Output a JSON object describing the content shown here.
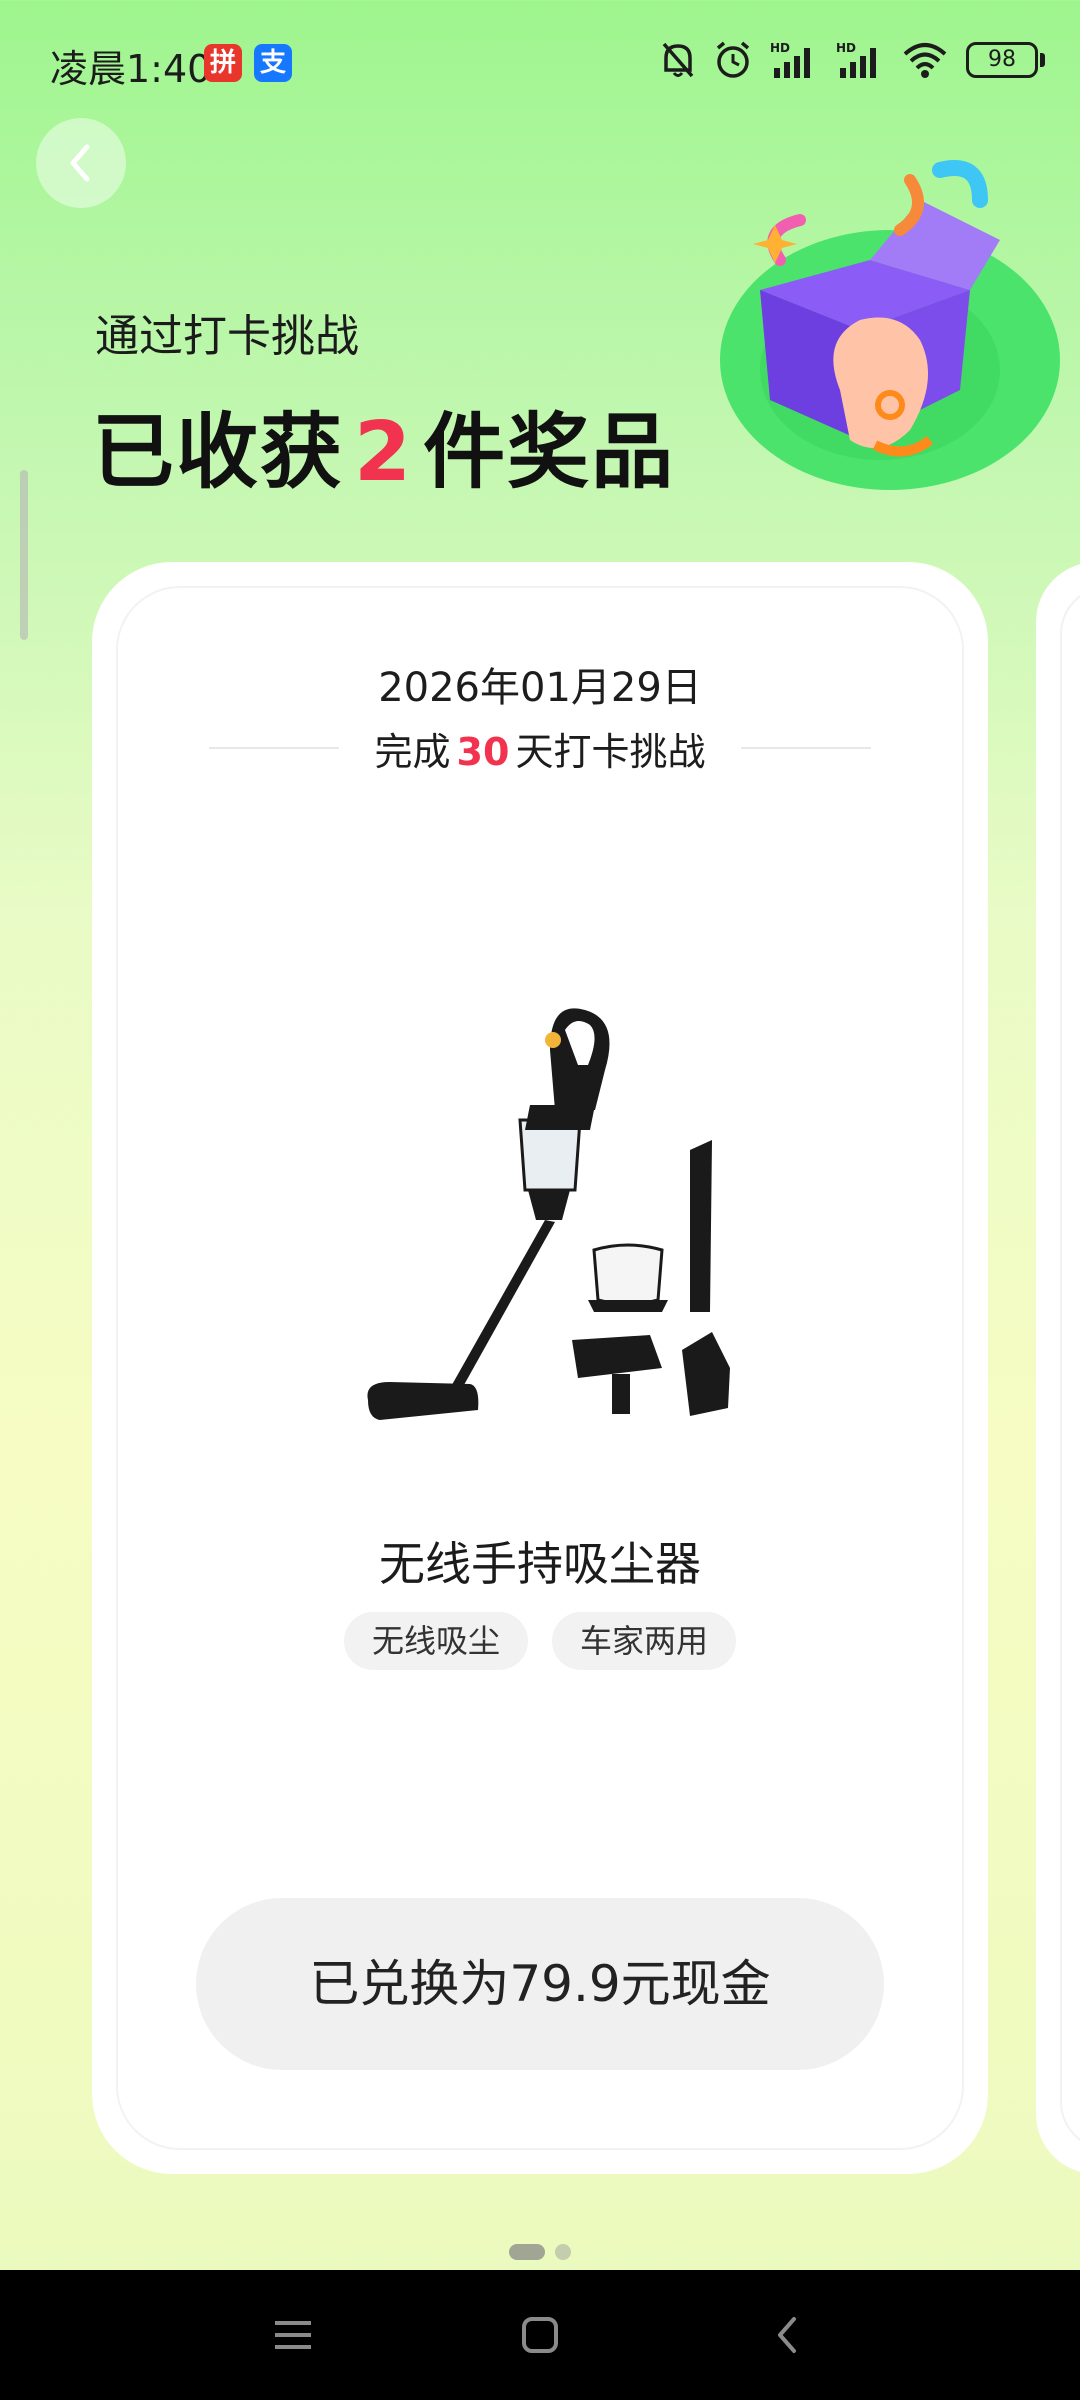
{
  "status_bar": {
    "time": "凌晨1:40",
    "app_badges": [
      {
        "name": "pinduoduo-badge",
        "glyph": "拼",
        "color": "#e8362c"
      },
      {
        "name": "alipay-badge",
        "glyph": "支",
        "color": "#1677ff"
      }
    ],
    "icons": [
      "mute-bell-icon",
      "alarm-icon",
      "hd-signal-icon",
      "hd-signal-icon",
      "wifi-icon"
    ],
    "battery": "98"
  },
  "header": {
    "subtitle": "通过打卡挑战",
    "headline_prefix": "已收获",
    "prize_count": "2",
    "headline_suffix": "件奖品"
  },
  "card": {
    "date": "2026年01月29日",
    "challenge_prefix": "完成",
    "challenge_days": "30",
    "challenge_suffix": "天打卡挑战",
    "product_name": "无线手持吸尘器",
    "tags": [
      "无线吸尘",
      "车家两用"
    ],
    "exchange_label": "已兑换为79.9元现金"
  },
  "pagination": {
    "total": 2,
    "active": 1
  },
  "colors": {
    "accent_red": "#f2334f",
    "bg_green": "#9ef58e",
    "bg_yellow": "#f6fcc4"
  }
}
